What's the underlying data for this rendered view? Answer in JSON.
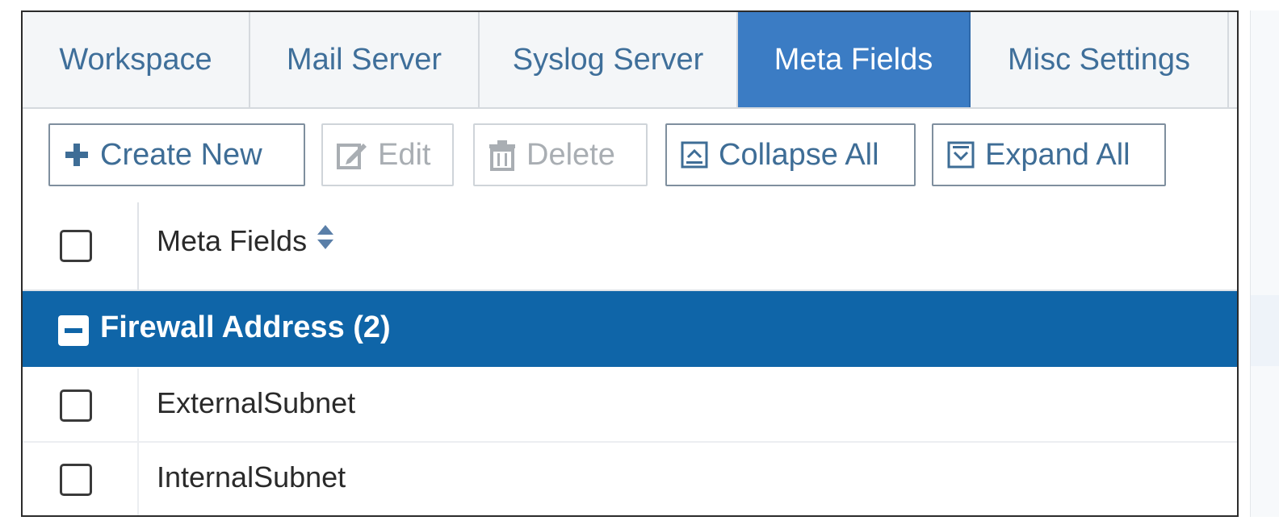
{
  "tabs": [
    {
      "label": "Workspace"
    },
    {
      "label": "Mail Server"
    },
    {
      "label": "Syslog Server"
    },
    {
      "label": "Meta Fields",
      "active": true
    },
    {
      "label": "Misc Settings"
    }
  ],
  "toolbar": {
    "create_new": {
      "label": "Create New",
      "icon": "plus-icon",
      "enabled": true
    },
    "edit": {
      "label": "Edit",
      "icon": "edit-icon",
      "enabled": false
    },
    "delete": {
      "label": "Delete",
      "icon": "trash-icon",
      "enabled": false
    },
    "collapse_all": {
      "label": "Collapse All",
      "icon": "collapse-icon",
      "enabled": true
    },
    "expand_all": {
      "label": "Expand All",
      "icon": "expand-icon",
      "enabled": true
    }
  },
  "table": {
    "column_header": "Meta Fields",
    "sort_icon": "sort-icon",
    "groups": [
      {
        "label": "Firewall Address (2)",
        "expanded": true,
        "rows": [
          {
            "name": "ExternalSubnet",
            "checked": false
          },
          {
            "name": "InternalSubnet",
            "checked": false
          }
        ]
      }
    ]
  },
  "colors": {
    "active_tab": "#3b7cc4",
    "group_row": "#0f65a8",
    "link_text": "#3f6f9a"
  }
}
